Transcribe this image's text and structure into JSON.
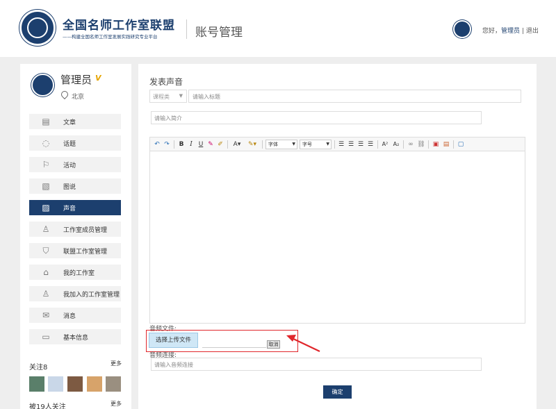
{
  "header": {
    "site_title": "全国名师工作室联盟",
    "site_subtitle": "——构建全国名师工作室发展实践研究专业平台",
    "page_title": "账号管理",
    "greeting": "您好，",
    "user_name": "管理员",
    "separator": "|",
    "logout": "退出"
  },
  "profile": {
    "name": "管理员",
    "badge": "V",
    "location": "北京"
  },
  "menu": [
    {
      "label": "文章",
      "icon": "document-icon",
      "glyph": "▤"
    },
    {
      "label": "话题",
      "icon": "chat-bubble-icon",
      "glyph": "◌"
    },
    {
      "label": "活动",
      "icon": "flag-icon",
      "glyph": "⚐"
    },
    {
      "label": "图说",
      "icon": "image-icon",
      "glyph": "▧"
    },
    {
      "label": "声音",
      "icon": "audio-image-icon",
      "glyph": "▨"
    },
    {
      "label": "工作室成员管理",
      "icon": "member-icon",
      "glyph": "♙"
    },
    {
      "label": "联盟工作室管理",
      "icon": "shield-icon",
      "glyph": "⛉"
    },
    {
      "label": "我的工作室",
      "icon": "home-icon",
      "glyph": "⌂"
    },
    {
      "label": "我加入的工作室管理",
      "icon": "add-user-icon",
      "glyph": "♙"
    },
    {
      "label": "消息",
      "icon": "mail-icon",
      "glyph": "✉"
    },
    {
      "label": "基本信息",
      "icon": "id-card-icon",
      "glyph": "▭"
    }
  ],
  "active_menu": "声音",
  "follow": {
    "following_label": "关注8",
    "more_label": "更多",
    "followers_label": "被19人关注",
    "followers_more": "更多",
    "avatar_colors": [
      "#5a7f6a",
      "#c9d7e8",
      "#7d5a42",
      "#d7a36a",
      "#9a8f80"
    ]
  },
  "form": {
    "heading": "发表声音",
    "category_value": "课程类",
    "title_placeholder": "请输入标题",
    "intro_placeholder": "请输入简介",
    "toolbar": {
      "undo": "↶",
      "redo": "↷",
      "bold": "B",
      "italic": "I",
      "underline": "U",
      "font_family": "字体",
      "font_size": "字号"
    },
    "audio_file_label": "音频文件:",
    "upload_button": "选择上传文件",
    "cancel_button": "取消",
    "audio_link_label": "音频连接:",
    "audio_link_placeholder": "请输入音频连接",
    "confirm_button": "确定"
  },
  "colors": {
    "brand": "#1c3f6e",
    "highlight_box": "#e0262b",
    "upload_button_bg": "#cfe7f6"
  }
}
